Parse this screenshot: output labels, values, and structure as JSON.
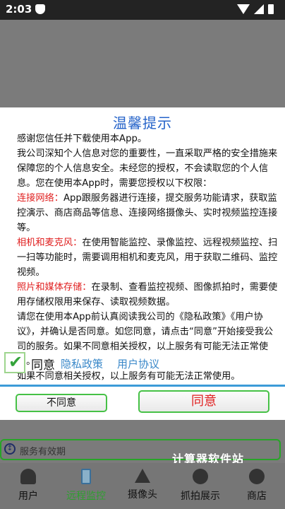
{
  "status_bar": {
    "time": "2:03",
    "shield_icon": "shield-icon",
    "wifi_icon": "wifi-icon",
    "signal_icon": "signal-icon",
    "battery_icon": "battery-icon"
  },
  "dialog": {
    "title": "温馨提示",
    "paragraphs": {
      "p1": "感谢您信任并下载使用本App。",
      "p2": "我公司深知个人信息对您的重要性，一直采取严格的安全措施来保障您的个人信息安全。未经您的授权，不会读取您的个人信息。您在使用本App时，需要您授权以下权限：",
      "network_label": "连接网络：",
      "network_text": "App跟服务器进行连接，提交服务功能请求，获取监控演示、商店商品等信息、连接网络摄像头、实时视频监控连接等。",
      "camera_label": "相机和麦克风：",
      "camera_text": "在使用智能监控、录像监控、远程视频监控、扫一扫等功能时，需要调用相机和麦克风，用于获取二维码、监控视频。",
      "storage_label": "照片和媒体存储：",
      "storage_text": "在录制、查看监控视频、图像抓拍时，需要使用存储权限用来保存、读取视频数据。",
      "p_read": "请您在使用本App前认真阅读我公司的《隐私政策》《用户协议》，并确认是否同意。如您同意，请点击“同意”开始接受我公司的服务。如果不同意相关授权，以上服务有可能无法正常使用。",
      "p_last": "如果不同意相关授权，以上服务有可能无法正常使用。"
    },
    "agree_checkbox_label": "同意",
    "privacy_link": "隐私政策",
    "agreement_link": "用户协议",
    "disagree_button": "不同意",
    "agree_button": "同意"
  },
  "service_bar": {
    "text": "服务有效期"
  },
  "watermark": "计算器软件站",
  "bottom_nav": {
    "items": [
      {
        "label": "用户",
        "icon": "user-icon"
      },
      {
        "label": "远程监控",
        "icon": "phone-icon",
        "active": true
      },
      {
        "label": "摄像头",
        "icon": "home-icon"
      },
      {
        "label": "抓拍展示",
        "icon": "eye-icon"
      },
      {
        "label": "商店",
        "icon": "cart-icon"
      }
    ]
  },
  "colors": {
    "title_blue": "#2563c9",
    "link_blue": "#3a88c9",
    "red": "#e02020",
    "green": "#2ea02e"
  }
}
